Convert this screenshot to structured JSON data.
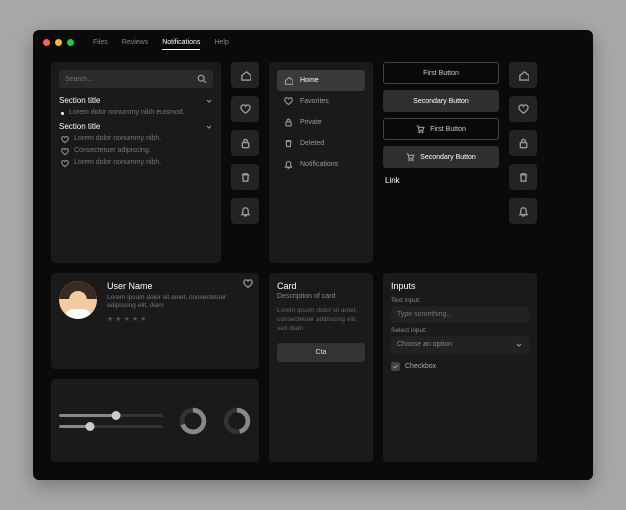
{
  "menubar": {
    "files": "Files",
    "reviews": "Reviews",
    "notifications": "Notifications",
    "help": "Help"
  },
  "search": {
    "placeholder": "Search..."
  },
  "sections": {
    "a": {
      "title": "Section title",
      "items": [
        "Lorem dolor nonummy nibh euismod."
      ]
    },
    "b": {
      "title": "Section title",
      "items": [
        "Lorem dolor nonummy nibh.",
        "Consectetuer adipiscing.",
        "Lorem dolor nonummy nibh."
      ]
    }
  },
  "nav": {
    "home": "Home",
    "favorites": "Favorites",
    "private": "Private",
    "deleted": "Deleted",
    "notifications": "Notifications"
  },
  "buttons": {
    "first": "First Button",
    "secondary": "Secondary Button",
    "cart_first": "First Button",
    "cart_secondary": "Secondary Button",
    "link": "Link"
  },
  "user": {
    "name": "User Name",
    "desc": "Lorem ipsum dolor sit amet, consectetuer adipiscing elit, diam"
  },
  "sliders": {
    "a": 55,
    "b": 30
  },
  "donuts": {
    "a": 70,
    "b": 45
  },
  "card": {
    "title": "Card",
    "subtitle": "Description of card",
    "body": "Lorem ipsum dolor sit amet, consectetuer adipiscing elit, sed diam",
    "cta": "Cta"
  },
  "inputs": {
    "title": "Inputs",
    "text_label": "Text input:",
    "text_placeholder": "Type something...",
    "select_label": "Select input:",
    "select_placeholder": "Choose an option",
    "checkbox_label": "Checkbox"
  }
}
